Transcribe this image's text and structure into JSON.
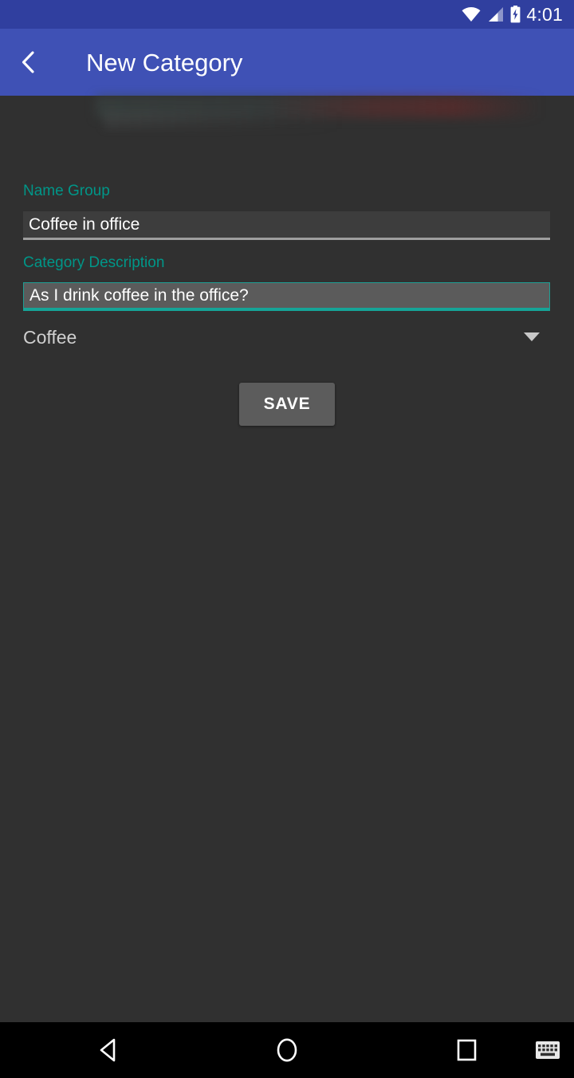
{
  "status_bar": {
    "time": "4:01",
    "icons": [
      "wifi-icon",
      "cellular-signal-icon",
      "battery-charging-icon"
    ],
    "background_color": "#303f9f"
  },
  "app_bar": {
    "title": "New Category",
    "back_icon": "chevron-left-icon",
    "background_color": "#3f51b5",
    "title_color": "#ffffff"
  },
  "form": {
    "accent_color": "#009688",
    "name_group": {
      "label": "Name Group",
      "value": "Coffee in office",
      "focused": false
    },
    "category_description": {
      "label": "Category Description",
      "value": "As I drink coffee in the office?",
      "focused": true
    },
    "category_spinner": {
      "selected": "Coffee",
      "caret_icon": "caret-down-icon"
    },
    "save_button": {
      "label": "SAVE",
      "background_color": "#5c5c5c"
    }
  },
  "nav_bar": {
    "background_color": "#000000",
    "buttons": [
      {
        "name": "back",
        "icon": "triangle-back-icon"
      },
      {
        "name": "home",
        "icon": "circle-home-icon"
      },
      {
        "name": "recents",
        "icon": "square-recents-icon"
      },
      {
        "name": "ime-switcher",
        "icon": "keyboard-icon"
      }
    ]
  },
  "page": {
    "background_color": "#303030"
  }
}
